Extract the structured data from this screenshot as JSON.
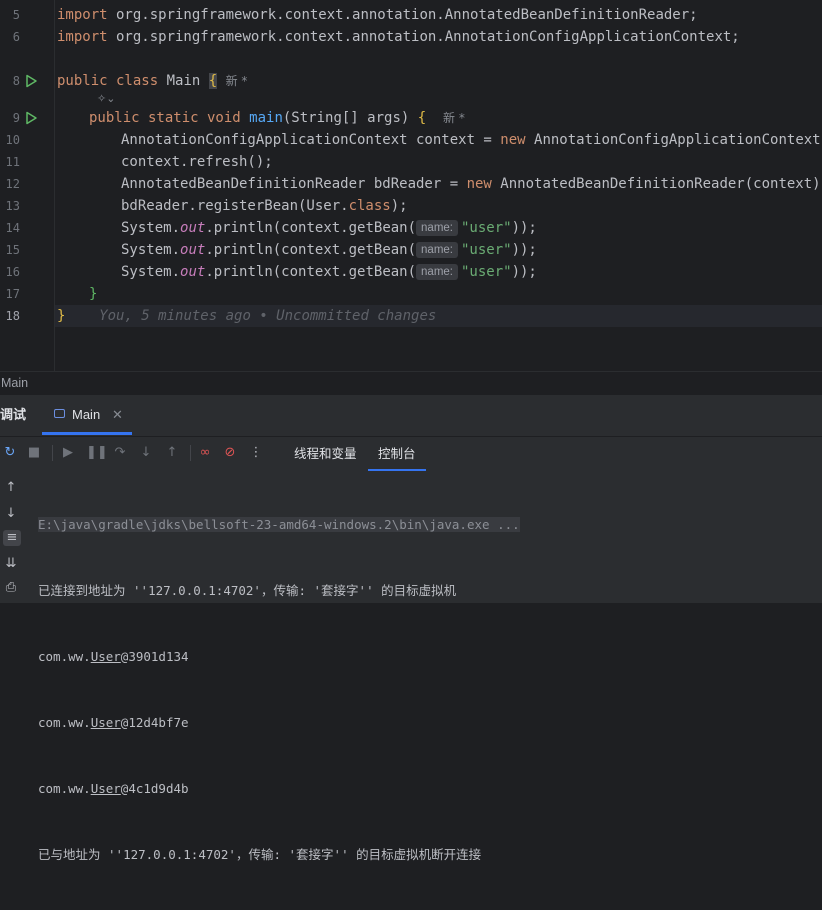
{
  "editor": {
    "line_numbers": [
      "5",
      "6",
      "8",
      "9",
      "10",
      "11",
      "12",
      "13",
      "14",
      "15",
      "16",
      "17",
      "18"
    ],
    "import1_kw": "import",
    "import1_path": " org.springframework.context.annotation.AnnotatedBeanDefinitionReader;",
    "import2_kw": "import",
    "import2_path": " org.springframework.context.annotation.AnnotationConfigApplicationContext;",
    "class_kw": "public class",
    "class_name": " Main ",
    "open_brace": "{",
    "new_hint": "新 *",
    "method_kw": "public static void",
    "method_name": "main",
    "method_params": "(String[] args) ",
    "line10_a": "AnnotationConfigApplicationContext context = ",
    "kw_new": "new",
    "line10_b": " AnnotationConfigApplicationContext();",
    "line11": "context.refresh();",
    "line12_a": "AnnotatedBeanDefinitionReader bdReader = ",
    "line12_b": " AnnotatedBeanDefinitionReader(context);",
    "line13_a": "bdReader.registerBean(User.",
    "kw_class": "class",
    "line13_b": ");",
    "sys": "System.",
    "out": "out",
    "println": ".println(context.getBean(",
    "param_hint": "name:",
    "user_str": "\"user\"",
    "println_end": "));",
    "close_method": "}",
    "close_class": "}",
    "blame": "You, 5 minutes ago • Uncommitted changes"
  },
  "breadcrumb": "Main",
  "panel": {
    "title": "调试",
    "tab_label": "Main",
    "subtabs": [
      "线程和变量",
      "控制台"
    ]
  },
  "console": {
    "cmd": "E:\\java\\gradle\\jdks\\bellsoft-23-amd64-windows.2\\bin\\java.exe ...",
    "connected": "已连接到地址为 ''127.0.0.1:4702'，传输: '套接字'' 的目标虚拟机",
    "pkg": "com.ww.",
    "cls": "User",
    "hashes": [
      "@3901d134",
      "@12d4bf7e",
      "@4c1d9d4b"
    ],
    "disconnected": "已与地址为 ''127.0.0.1:4702'，传输: '套接字'' 的目标虚拟机断开连接"
  }
}
